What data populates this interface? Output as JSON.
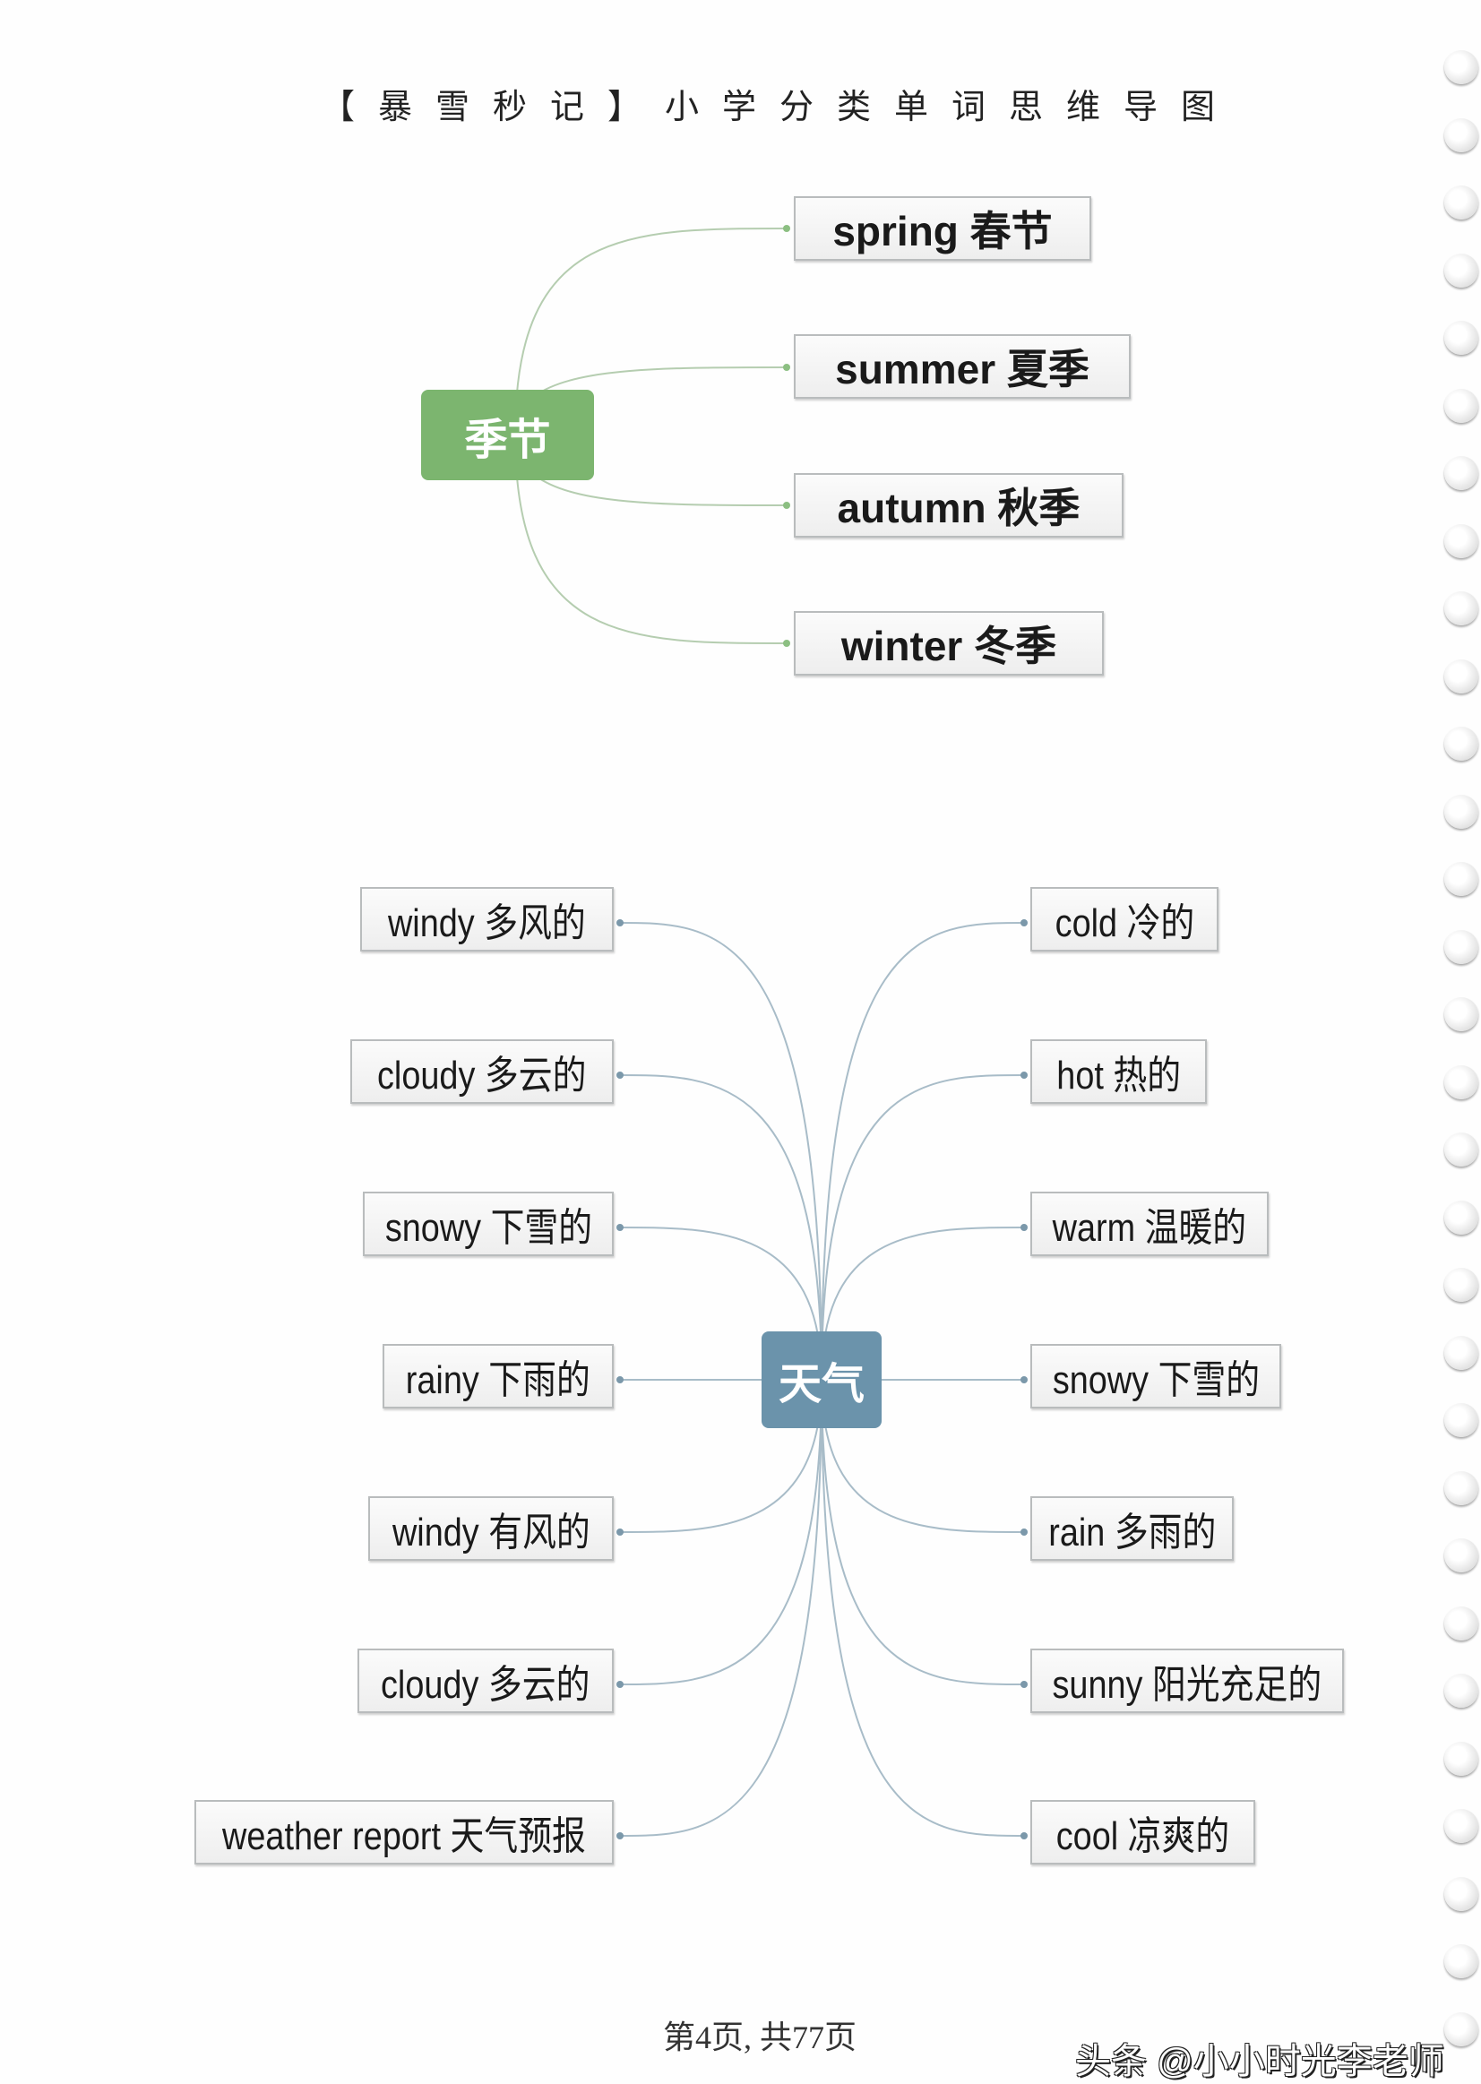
{
  "title": "【暴雪秒记】小学分类单词思维导图",
  "colors": {
    "seasons_root": "#7cb56f",
    "weather_root": "#6b93ab",
    "link": "#a8bcc8"
  },
  "seasons": {
    "root": "季节",
    "items": [
      "spring 春节",
      "summer 夏季",
      "autumn 秋季",
      "winter 冬季"
    ]
  },
  "weather": {
    "root": "天气",
    "left": [
      "windy 多风的",
      "cloudy 多云的",
      "snowy 下雪的",
      "rainy 下雨的",
      "windy 有风的",
      "cloudy 多云的",
      "weather report 天气预报"
    ],
    "right": [
      "cold 冷的",
      "hot 热的",
      "warm 温暖的",
      "snowy 下雪的",
      "rain 多雨的",
      "sunny 阳光充足的",
      "cool 凉爽的"
    ]
  },
  "footer": "第4页, 共77页",
  "watermark": "头条 @小小时光李老师"
}
